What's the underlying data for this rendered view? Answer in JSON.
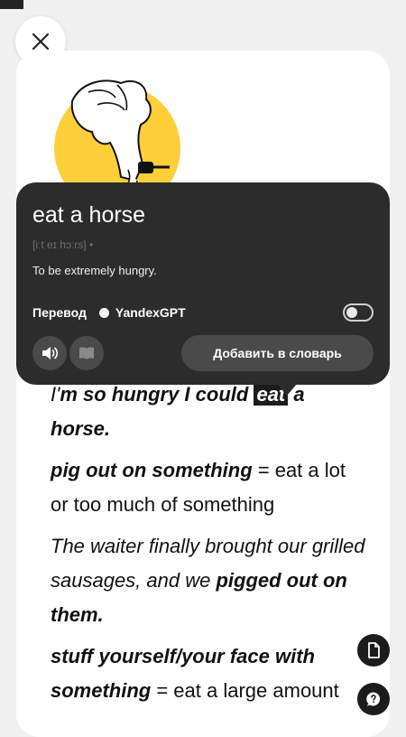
{
  "popup": {
    "word": "eat a horse",
    "transcription": "[iːt eɪ hɔːrs] •",
    "definition": "To be extremely hungry.",
    "translation_label": "Перевод",
    "translation_provider": "YandexGPT",
    "translation_toggle_on": false,
    "add_button_label": "Добавить в словарь"
  },
  "article": {
    "example1": {
      "before": "I'",
      "bold_part": "m so hungry I could",
      "highlight": "eat",
      "after": " a horse."
    },
    "term2": {
      "phrase": "pig out on something",
      "meaning": " = eat a lot or too much of something"
    },
    "example2": {
      "plain": "The waiter finally brought our grilled sausages, and we ",
      "bold_part": "pigged out on them."
    },
    "term3": {
      "phrase": "stuff yourself/your face with something",
      "meaning": " = eat a large amount"
    }
  },
  "icons": {
    "close": "close-icon",
    "speaker": "speaker-icon",
    "book": "book-icon",
    "document": "document-icon",
    "help": "question-icon"
  },
  "colors": {
    "popup_bg": "#2c2c2c",
    "accent_yellow": "#ffcf3a",
    "page_bg": "#f0f0f0"
  }
}
